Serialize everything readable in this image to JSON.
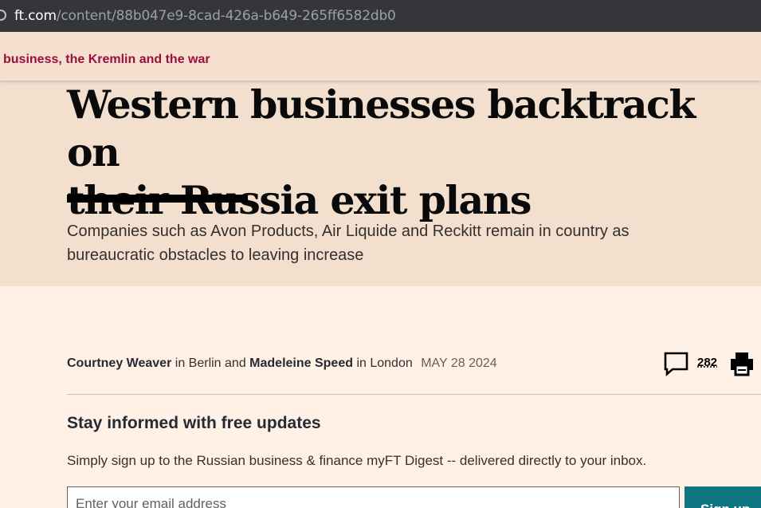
{
  "browser": {
    "url_domain": "ft.com",
    "url_path": "/content/88b047e9-8cad-426a-b649-265ff6582db0"
  },
  "topic_bar": {
    "label": "business, the Kremlin and the war"
  },
  "article": {
    "headline_line1": "Western businesses backtrack on",
    "headline_line2": "their Russia exit plans",
    "standfirst": "Companies such as Avon Products, Air Liquide and Reckitt remain in country as bureaucratic obstacles to leaving increase",
    "byline": {
      "author1": "Courtney Weaver",
      "in1": "in Berlin and",
      "author2": "Madeleine Speed",
      "in2": "in London",
      "date": "MAY 28 2024"
    },
    "comment_count": "282"
  },
  "promo": {
    "title": "Stay informed with free updates",
    "text": "Simply sign up to the Russian business & finance myFT Digest -- delivered directly to your inbox.",
    "email_placeholder": "Enter your email address",
    "signup_label": "Sign up"
  },
  "colors": {
    "brand_claret": "#990f3d",
    "page_bg": "#fff1e5",
    "hero_bg": "#f2dfce",
    "teal": "#0d7680"
  }
}
